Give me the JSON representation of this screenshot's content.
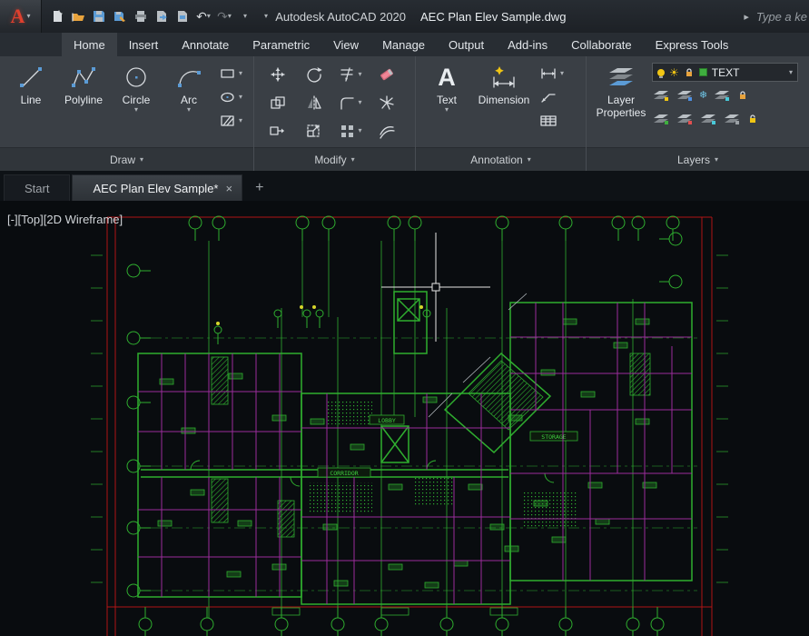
{
  "icons": {
    "dropdown": "▾",
    "close": "×",
    "plus": "+",
    "nav_right": "▸",
    "undo": "↶",
    "redo": "↷",
    "sun": "☀",
    "snowflake": "❄",
    "logo_letter": "A",
    "text_tool": "A"
  },
  "titlebar": {
    "app_title": "Autodesk AutoCAD 2020",
    "doc_title": "AEC Plan Elev Sample.dwg",
    "search_text": "Type a ke"
  },
  "ribbon_tabs": [
    "Home",
    "Insert",
    "Annotate",
    "Parametric",
    "View",
    "Manage",
    "Output",
    "Add-ins",
    "Collaborate",
    "Express Tools"
  ],
  "ribbon": {
    "draw": {
      "label": "Draw",
      "line": "Line",
      "polyline": "Polyline",
      "circle": "Circle",
      "arc": "Arc"
    },
    "modify": {
      "label": "Modify"
    },
    "annotation": {
      "label": "Annotation",
      "text": "Text",
      "dimension": "Dimension"
    },
    "layers": {
      "label": "Layers",
      "properties_line1": "Layer",
      "properties_line2": "Properties",
      "current_layer": "TEXT"
    }
  },
  "file_tabs": {
    "start": "Start",
    "document": "AEC Plan Elev Sample*"
  },
  "viewport": {
    "controls": "[-][Top][2D Wireframe]"
  },
  "drawing": {
    "labels": {
      "corridor": "CORRIDOR",
      "lobby": "LOBBY",
      "storage": "STORAGE"
    },
    "colors": {
      "background": "#090c0f",
      "green": "#2fae2f",
      "bright_green": "#3ecf3e",
      "magenta": "#9b2d9b",
      "red": "#b01515",
      "crosshair": "#e6e6e6",
      "yellow": "#d6d62a"
    }
  }
}
